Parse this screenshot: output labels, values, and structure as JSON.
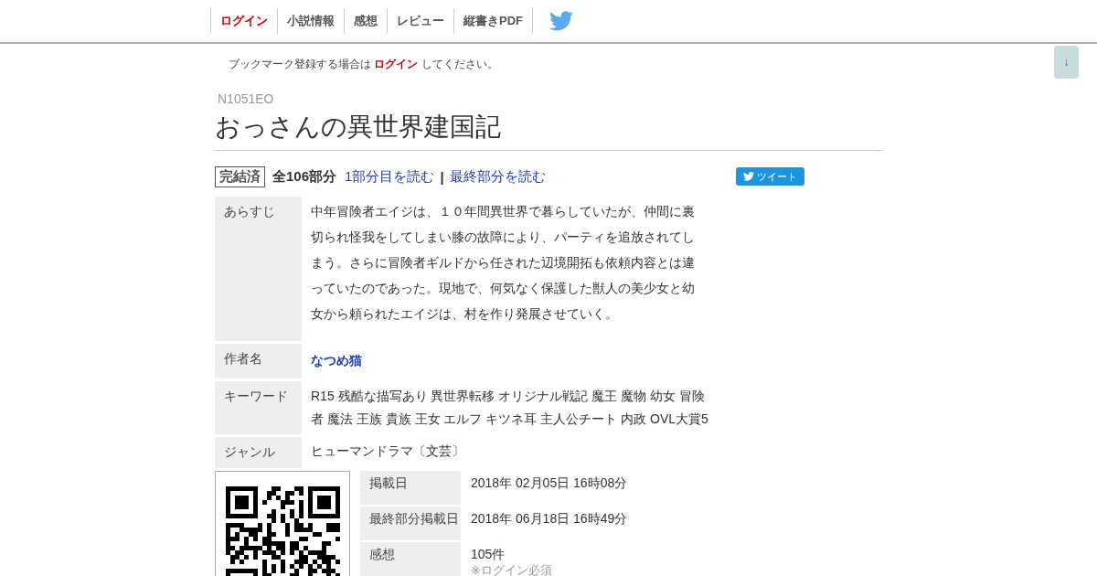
{
  "nav": [
    {
      "label": "ログイン",
      "kind": "login"
    },
    {
      "label": "小説情報",
      "kind": "link"
    },
    {
      "label": "感想",
      "kind": "link"
    },
    {
      "label": "レビュー",
      "kind": "link"
    },
    {
      "label": "縦書きPDF",
      "kind": "link"
    }
  ],
  "scroll_button": {
    "label": "↓"
  },
  "bookmark_notice": {
    "before": "ブックマーク登録する場合は",
    "link": "ログイン",
    "after": "してください。"
  },
  "ncode": "N1051EO",
  "title": "おっさんの異世界建国記",
  "status": {
    "badge": "完結済",
    "parts": "全106部分",
    "first_link": "1部分目を読む",
    "separator": "|",
    "last_link": "最終部分を読む"
  },
  "tweet_button": {
    "label": "ツイート"
  },
  "info_table": [
    {
      "label": "あらすじ",
      "kind": "text",
      "value": "中年冒険者エイジは、１０年間異世界で暮らしていたが、仲間に裏切られ怪我をしてしまい膝の故障により、パーティを追放されてしまう。さらに冒険者ギルドから任された辺境開拓も依頼内容とは違っていたのであった。現地で、何気なく保護した獣人の美少女と幼女から頼られたエイジは、村を作り発展させていく。"
    },
    {
      "label": "作者名",
      "kind": "link",
      "value": "なつめ猫"
    },
    {
      "label": "キーワード",
      "kind": "text",
      "value": "R15 残酷な描写あり 異世界転移  オリジナル戦記 魔王 魔物 幼女 冒険者 魔法 王族 貴族 王女 エルフ キツネ耳 主人公チート 内政 OVL大賞5"
    },
    {
      "label": "ジャンル",
      "kind": "text",
      "value": "ヒューマンドラマ〔文芸〕"
    }
  ],
  "dates_table": [
    {
      "label": "掲載日",
      "value": "2018年 02月05日 16時08分"
    },
    {
      "label": "最終部分掲載日",
      "value": "2018年 06月18日 16時49分"
    },
    {
      "label": "感想",
      "value": "105件",
      "note": "※ログイン必須"
    }
  ]
}
